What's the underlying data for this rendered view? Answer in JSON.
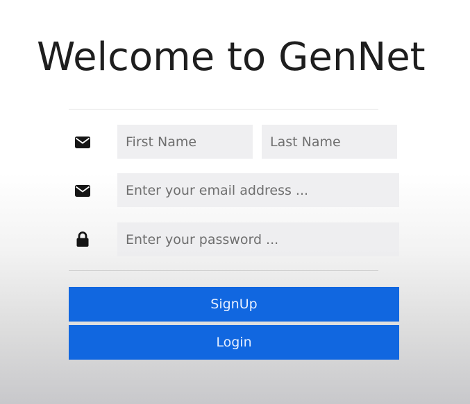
{
  "page": {
    "title": "Welcome to GenNet"
  },
  "form": {
    "first_name": {
      "value": "",
      "placeholder": "First Name",
      "icon": "envelope-icon"
    },
    "last_name": {
      "value": "",
      "placeholder": "Last Name"
    },
    "email": {
      "value": "",
      "placeholder": "Enter your email address ...",
      "icon": "envelope-icon"
    },
    "password": {
      "value": "",
      "placeholder": "Enter your password ...",
      "icon": "lock-icon"
    },
    "signup_label": "SignUp",
    "login_label": "Login"
  },
  "colors": {
    "primary_button": "#1167e0",
    "input_background": "#ececee",
    "title_text": "#1e1e1e"
  }
}
